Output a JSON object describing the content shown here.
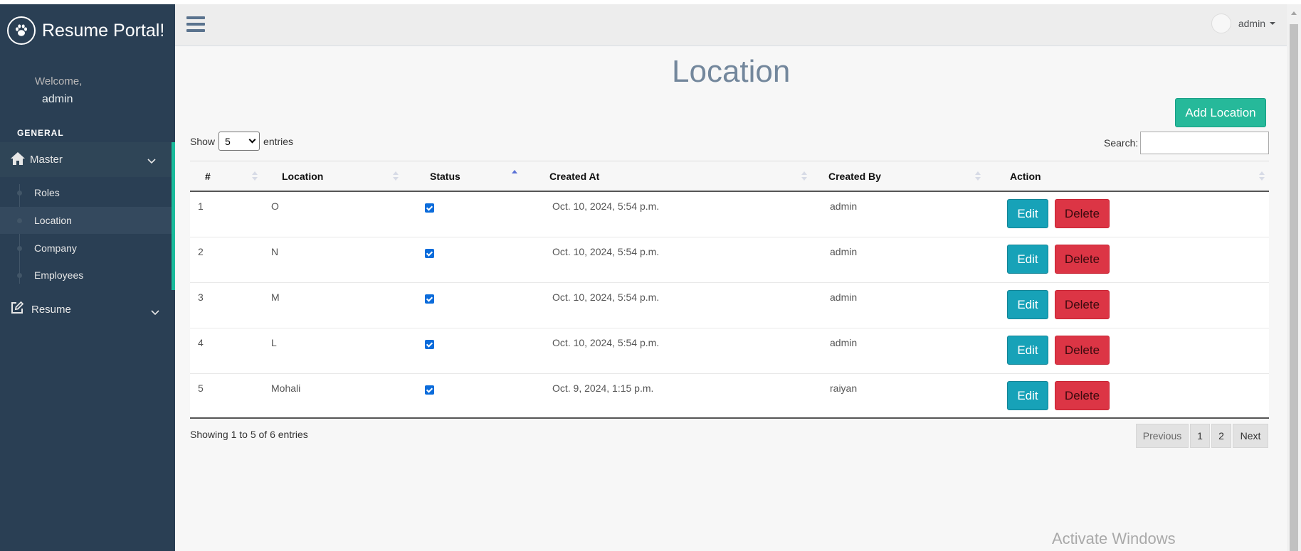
{
  "brand": {
    "title": "Resume Portal!",
    "icon": "paw-icon"
  },
  "sidebar": {
    "welcome": "Welcome,",
    "username": "admin",
    "section": "GENERAL",
    "master": {
      "label": "Master",
      "icon": "home-icon"
    },
    "submenu": [
      {
        "label": "Roles"
      },
      {
        "label": "Location",
        "active": true
      },
      {
        "label": "Company"
      },
      {
        "label": "Employees"
      }
    ],
    "resume": {
      "label": "Resume",
      "icon": "edit-icon"
    }
  },
  "topnav": {
    "user": "admin"
  },
  "main": {
    "title": "Location",
    "add_button": "Add Location",
    "show_label": "Show",
    "entries_value": "5",
    "entries_label": "entries",
    "search_label": "Search:",
    "search_value": "",
    "columns": [
      "#",
      "Location",
      "Status",
      "Created At",
      "Created By",
      "Action"
    ],
    "rows": [
      {
        "id": "1",
        "location": "O",
        "status": true,
        "created_at": "Oct. 10, 2024, 5:54 p.m.",
        "created_by": "admin"
      },
      {
        "id": "2",
        "location": "N",
        "status": true,
        "created_at": "Oct. 10, 2024, 5:54 p.m.",
        "created_by": "admin"
      },
      {
        "id": "3",
        "location": "M",
        "status": true,
        "created_at": "Oct. 10, 2024, 5:54 p.m.",
        "created_by": "admin"
      },
      {
        "id": "4",
        "location": "L",
        "status": true,
        "created_at": "Oct. 10, 2024, 5:54 p.m.",
        "created_by": "admin"
      },
      {
        "id": "5",
        "location": "Mohali",
        "status": true,
        "created_at": "Oct. 9, 2024, 1:15 p.m.",
        "created_by": "raiyan"
      }
    ],
    "edit_label": "Edit",
    "delete_label": "Delete",
    "info": "Showing 1 to 5 of 6 entries",
    "pagination": {
      "previous": "Previous",
      "pages": [
        "1",
        "2"
      ],
      "next": "Next"
    }
  },
  "watermark": "Activate Windows",
  "colors": {
    "sidebar": "#2a3f54",
    "accent": "#1abb9c",
    "add": "#26b99a",
    "edit": "#17a2b8",
    "delete": "#dc3545"
  }
}
